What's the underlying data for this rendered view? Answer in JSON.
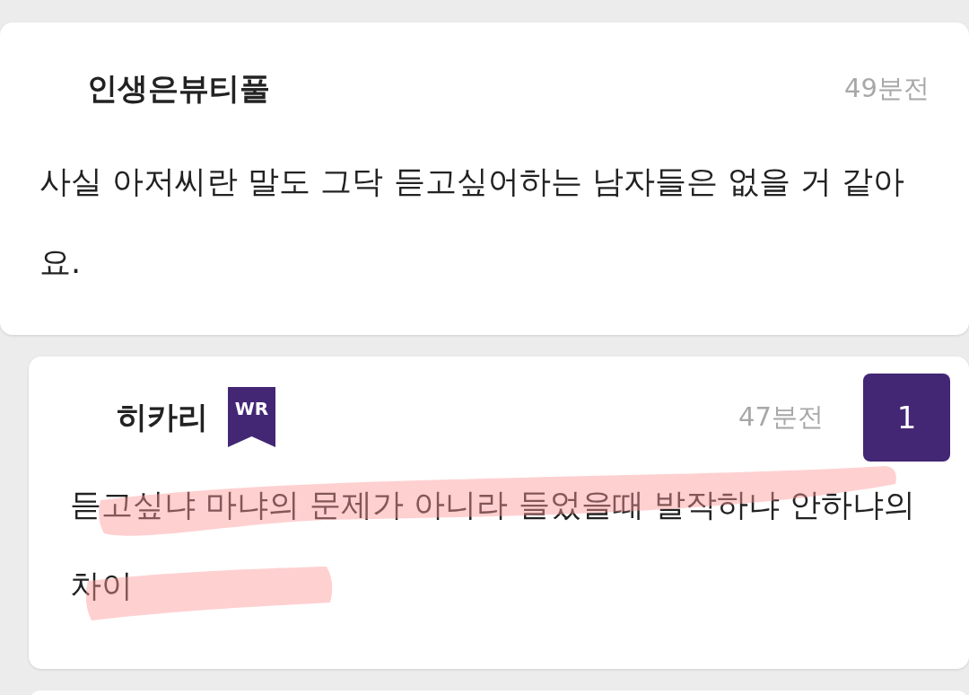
{
  "comments": [
    {
      "author": "인생은뷰티풀",
      "time": "49분전",
      "text": "사실 아저씨란 말도 그닥 듣고싶어하는 남자들은 없을 거 같아요.",
      "reply": false,
      "highlighted": false
    },
    {
      "author": "히카리",
      "badge": "WR",
      "time": "47분전",
      "count": "1",
      "text": "듣고싶냐 마냐의 문제가 아니라 들었을때 발작하냐 안하냐의 차이",
      "reply": true,
      "highlighted": true
    }
  ]
}
